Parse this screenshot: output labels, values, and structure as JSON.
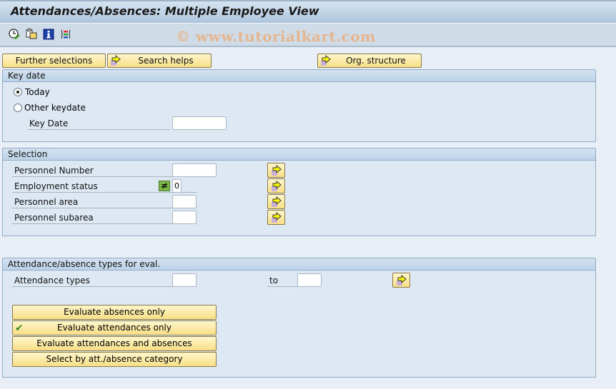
{
  "window": {
    "title": "Attendances/Absences: Multiple Employee View"
  },
  "toolbar": {
    "icons": [
      "execute-clock-icon",
      "get-variant-icon",
      "info-icon",
      "selection-options-icon"
    ],
    "watermark": "© www.tutorialkart.com"
  },
  "top_buttons": {
    "further_selections": "Further selections",
    "search_helps": "Search helps",
    "org_structure": "Org. structure"
  },
  "key_date_group": {
    "title": "Key date",
    "options": [
      {
        "label": "Today",
        "selected": true
      },
      {
        "label": "Other keydate",
        "selected": false
      }
    ],
    "key_date_label": "Key Date",
    "key_date_value": ""
  },
  "selection_group": {
    "title": "Selection",
    "fields": [
      {
        "label": "Personnel Number",
        "value": ""
      },
      {
        "label": "Employment status",
        "value": "0",
        "operator": "≠"
      },
      {
        "label": "Personnel area",
        "value": ""
      },
      {
        "label": "Personnel subarea",
        "value": ""
      }
    ]
  },
  "types_group": {
    "title": "Attendance/absence types for eval.",
    "attendance_types_label": "Attendance types",
    "from_value": "",
    "to_label": "to",
    "to_value": "",
    "eval_buttons": [
      {
        "label": "Evaluate absences only",
        "checked": false
      },
      {
        "label": "Evaluate attendances only",
        "checked": true
      },
      {
        "label": "Evaluate attendances and absences",
        "checked": false
      },
      {
        "label": "Select by att./absence category",
        "checked": false
      }
    ],
    "check_glyph": "✔"
  }
}
